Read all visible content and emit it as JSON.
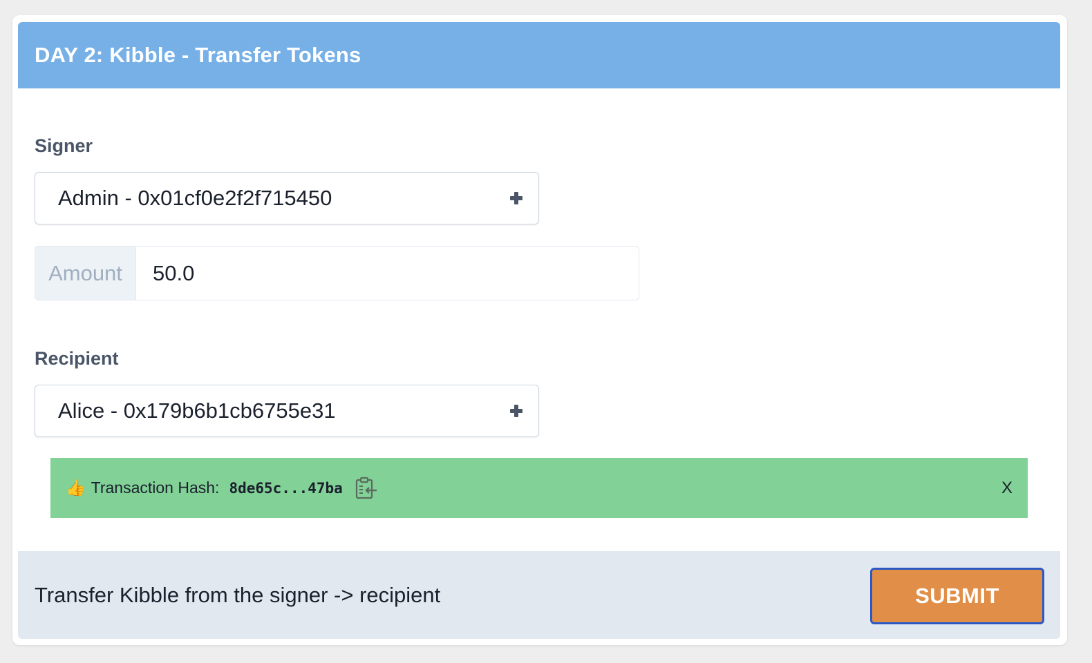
{
  "header": {
    "title": "DAY 2: Kibble - Transfer Tokens"
  },
  "signer": {
    "label": "Signer",
    "selected": "Admin - 0x01cf0e2f2f715450"
  },
  "amount": {
    "addon": "Amount",
    "value": "50.0"
  },
  "recipient": {
    "label": "Recipient",
    "selected": "Alice - 0x179b6b1cb6755e31"
  },
  "alert": {
    "icon": "👍",
    "label": "Transaction Hash:",
    "hash": "8de65c...47ba",
    "close": "X",
    "color": "#82d197"
  },
  "footer": {
    "description": "Transfer Kibble from the signer -> recipient",
    "submit_label": "SUBMIT"
  },
  "colors": {
    "header_bg": "#76b0e6",
    "submit_bg": "#e08e48",
    "submit_border": "#2b59c3",
    "footer_bg": "#e2e8f0"
  }
}
